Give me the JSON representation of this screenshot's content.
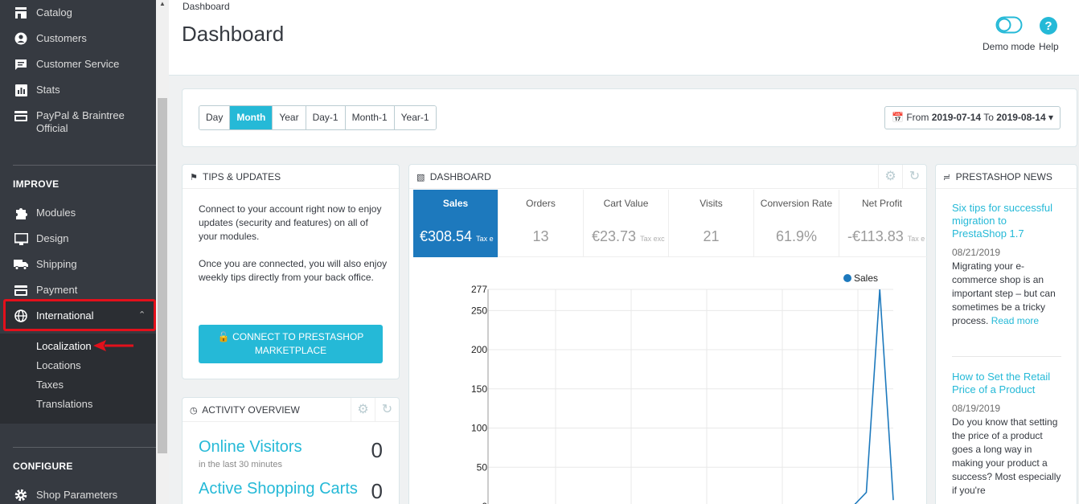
{
  "sidebar": {
    "items_top": [
      {
        "label": "Catalog",
        "icon": "store-icon"
      },
      {
        "label": "Customers",
        "icon": "user-icon"
      },
      {
        "label": "Customer Service",
        "icon": "chat-icon"
      },
      {
        "label": "Stats",
        "icon": "bar-chart-icon"
      },
      {
        "label": "PayPal & Braintree",
        "label2": "Official",
        "icon": "card-icon"
      }
    ],
    "improve_title": "IMPROVE",
    "improve_items": [
      {
        "label": "Modules",
        "icon": "puzzle-icon"
      },
      {
        "label": "Design",
        "icon": "monitor-icon"
      },
      {
        "label": "Shipping",
        "icon": "truck-icon"
      },
      {
        "label": "Payment",
        "icon": "credit-card-icon"
      },
      {
        "label": "International",
        "icon": "globe-icon"
      }
    ],
    "international_sub": [
      "Localization",
      "Locations",
      "Taxes",
      "Translations"
    ],
    "configure_title": "CONFIGURE",
    "configure_items": [
      {
        "label": "Shop Parameters",
        "icon": "gear-icon"
      }
    ]
  },
  "header": {
    "breadcrumb": "Dashboard",
    "title": "Dashboard",
    "demo_mode": "Demo mode",
    "help": "Help"
  },
  "period": {
    "buttons": [
      "Day",
      "Month",
      "Year",
      "Day-1",
      "Month-1",
      "Year-1"
    ],
    "active": "Month",
    "from_label": "From",
    "from": "2019-07-14",
    "to_label": "To",
    "to": "2019-08-14"
  },
  "tips": {
    "title": "TIPS & UPDATES",
    "p1": "Connect to your account right now to enjoy updates (security and features) on all of your modules.",
    "p2": "Once you are connected, you will also enjoy weekly tips directly from your back office.",
    "button": "CONNECT TO PRESTASHOP MARKETPLACE"
  },
  "activity": {
    "title": "ACTIVITY OVERVIEW",
    "online_label": "Online Visitors",
    "online_sub": "in the last 30 minutes",
    "online_value": "0",
    "carts_label": "Active Shopping Carts",
    "carts_value": "0"
  },
  "dashboard": {
    "title": "DASHBOARD",
    "kpis": [
      {
        "label": "Sales",
        "value": "€308.54",
        "suffix": "Tax e"
      },
      {
        "label": "Orders",
        "value": "13",
        "suffix": ""
      },
      {
        "label": "Cart Value",
        "value": "€23.73",
        "suffix": "Tax exc"
      },
      {
        "label": "Visits",
        "value": "21",
        "suffix": ""
      },
      {
        "label": "Conversion Rate",
        "value": "61.9%",
        "suffix": ""
      },
      {
        "label": "Net Profit",
        "value": "-€113.83",
        "suffix": "Tax exc"
      }
    ]
  },
  "chart_data": {
    "type": "line",
    "series": [
      {
        "name": "Sales",
        "values": [
          0,
          0,
          0,
          0,
          0,
          0,
          0,
          0,
          0,
          0,
          0,
          0,
          0,
          0,
          0,
          0,
          0,
          0,
          0,
          0,
          0,
          0,
          0,
          0,
          0,
          0,
          0,
          0,
          0,
          18,
          277,
          8
        ]
      }
    ],
    "yticks": [
      277,
      250,
      200,
      150,
      100,
      50,
      0
    ],
    "ylim": [
      0,
      277
    ],
    "legend": "top-right",
    "color": "#1d79bd",
    "grid": true
  },
  "news": {
    "title": "PRESTASHOP NEWS",
    "items": [
      {
        "title": "Six tips for successful migration to PrestaShop 1.7",
        "date": "08/21/2019",
        "text": "Migrating your e-commerce shop is an important step – but can sometimes be a tricky process.",
        "more": "Read more"
      },
      {
        "title": "How to Set the Retail Price of a Product",
        "date": "08/19/2019",
        "text": "Do you know that setting the price of a product goes a long way in making your product a success? Most especially if you're"
      }
    ]
  },
  "colors": {
    "accent": "#25b9d7",
    "sidebar": "#363a41",
    "highlight": "#e3101b"
  }
}
